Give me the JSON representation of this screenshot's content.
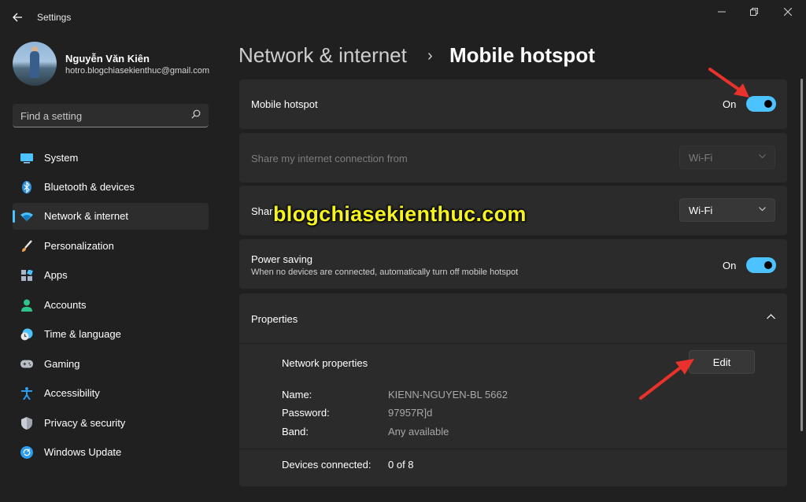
{
  "window": {
    "title": "Settings",
    "controls": [
      "minimize",
      "restore",
      "close"
    ]
  },
  "profile": {
    "name": "Nguyễn Văn Kiên",
    "email": "hotro.blogchiasekienthuc@gmail.com"
  },
  "search": {
    "placeholder": "Find a setting"
  },
  "sidebar": {
    "items": [
      {
        "label": "System",
        "icon": "monitor-icon",
        "active": false
      },
      {
        "label": "Bluetooth & devices",
        "icon": "bluetooth-icon",
        "active": false
      },
      {
        "label": "Network & internet",
        "icon": "wifi-icon",
        "active": true
      },
      {
        "label": "Personalization",
        "icon": "brush-icon",
        "active": false
      },
      {
        "label": "Apps",
        "icon": "apps-icon",
        "active": false
      },
      {
        "label": "Accounts",
        "icon": "person-icon",
        "active": false
      },
      {
        "label": "Time & language",
        "icon": "clock-globe-icon",
        "active": false
      },
      {
        "label": "Gaming",
        "icon": "gamepad-icon",
        "active": false
      },
      {
        "label": "Accessibility",
        "icon": "accessibility-icon",
        "active": false
      },
      {
        "label": "Privacy & security",
        "icon": "shield-icon",
        "active": false
      },
      {
        "label": "Windows Update",
        "icon": "update-icon",
        "active": false
      }
    ]
  },
  "header": {
    "parent": "Network & internet",
    "separator": "›",
    "current": "Mobile hotspot"
  },
  "hotspot": {
    "label": "Mobile hotspot",
    "state": "On"
  },
  "share_from": {
    "label": "Share my internet connection from",
    "value": "Wi-Fi",
    "disabled": true
  },
  "share_over": {
    "label": "Shar",
    "value": "Wi-Fi"
  },
  "power_saving": {
    "label": "Power saving",
    "description": "When no devices are connected, automatically turn off mobile hotspot",
    "state": "On"
  },
  "properties": {
    "label": "Properties",
    "expanded": true,
    "network_properties_label": "Network properties",
    "edit_label": "Edit",
    "fields": [
      {
        "key": "Name:",
        "value": "KIENN-NGUYEN-BL 5662"
      },
      {
        "key": "Password:",
        "value": "97957R]d"
      },
      {
        "key": "Band:",
        "value": "Any available"
      }
    ],
    "devices_connected_label": "Devices connected:",
    "devices_connected_value": "0 of 8"
  },
  "watermark": "blogchiasekienthuc.com",
  "colors": {
    "background": "#202020",
    "card": "#2b2b2b",
    "accent": "#4cc2ff",
    "watermark": "#f6f41c",
    "annotation_arrow": "#e8322b"
  }
}
